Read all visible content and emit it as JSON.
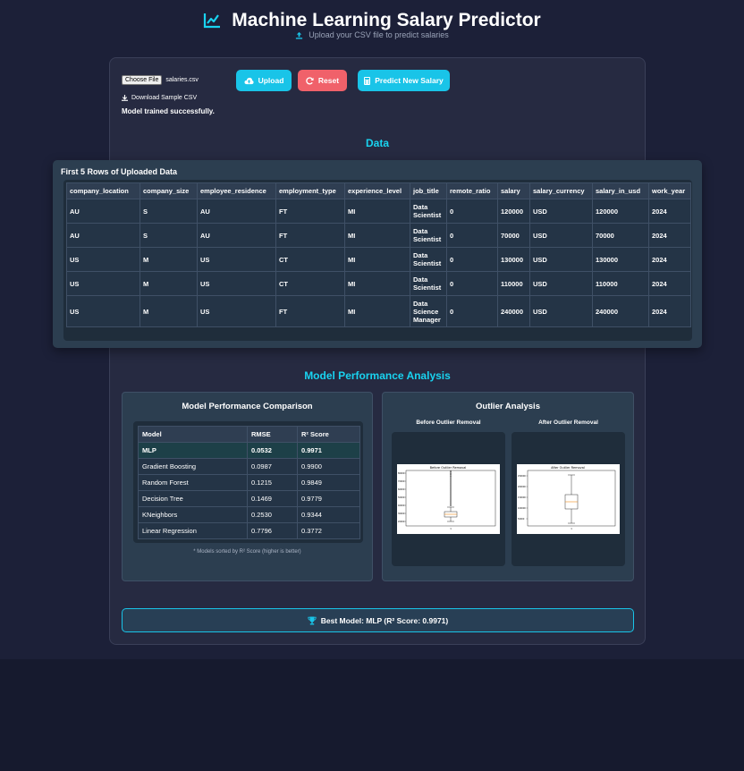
{
  "header": {
    "title": "Machine Learning Salary Predictor",
    "subtitle": "Upload your CSV file to predict salaries"
  },
  "upload": {
    "choose_file_label": "Choose File",
    "file_name": "salaries.csv",
    "upload_label": "Upload",
    "reset_label": "Reset",
    "predict_label": "Predict New Salary",
    "download_label": "Download Sample CSV",
    "status": "Model trained successfully."
  },
  "data_section": {
    "title": "Data",
    "panel_title": "First 5 Rows of Uploaded Data",
    "columns": [
      "company_location",
      "company_size",
      "employee_residence",
      "employment_type",
      "experience_level",
      "job_title",
      "remote_ratio",
      "salary",
      "salary_currency",
      "salary_in_usd",
      "work_year"
    ],
    "rows": [
      [
        "AU",
        "S",
        "AU",
        "FT",
        "MI",
        "Data Scientist",
        "0",
        "120000",
        "USD",
        "120000",
        "2024"
      ],
      [
        "AU",
        "S",
        "AU",
        "FT",
        "MI",
        "Data Scientist",
        "0",
        "70000",
        "USD",
        "70000",
        "2024"
      ],
      [
        "US",
        "M",
        "US",
        "CT",
        "MI",
        "Data Scientist",
        "0",
        "130000",
        "USD",
        "130000",
        "2024"
      ],
      [
        "US",
        "M",
        "US",
        "CT",
        "MI",
        "Data Scientist",
        "0",
        "110000",
        "USD",
        "110000",
        "2024"
      ],
      [
        "US",
        "M",
        "US",
        "FT",
        "MI",
        "Data Science Manager",
        "0",
        "240000",
        "USD",
        "240000",
        "2024"
      ]
    ]
  },
  "performance": {
    "section_title": "Model Performance Analysis",
    "comparison_title": "Model Performance Comparison",
    "columns": [
      "Model",
      "RMSE",
      "R² Score"
    ],
    "rows": [
      [
        "MLP",
        "0.0532",
        "0.9971"
      ],
      [
        "Gradient Boosting",
        "0.0987",
        "0.9900"
      ],
      [
        "Random Forest",
        "0.1215",
        "0.9849"
      ],
      [
        "Decision Tree",
        "0.1469",
        "0.9779"
      ],
      [
        "KNeighbors",
        "0.2530",
        "0.9344"
      ],
      [
        "Linear Regression",
        "0.7796",
        "0.3772"
      ]
    ],
    "note": "* Models sorted by R² Score (higher is better)"
  },
  "outliers": {
    "title": "Outlier Analysis",
    "before_label": "Before Outlier Removal",
    "after_label": "After Outlier Removal",
    "before_plot_title": "Before Outlier Removal",
    "after_plot_title": "After Outlier Removal",
    "x_tick": "1"
  },
  "best_model": "Best Model: MLP (R² Score: 0.9971)",
  "colors": {
    "accent": "#19c4e8",
    "reset": "#f0616a",
    "section_title": "#19d3f0",
    "background": "#1c2038"
  }
}
